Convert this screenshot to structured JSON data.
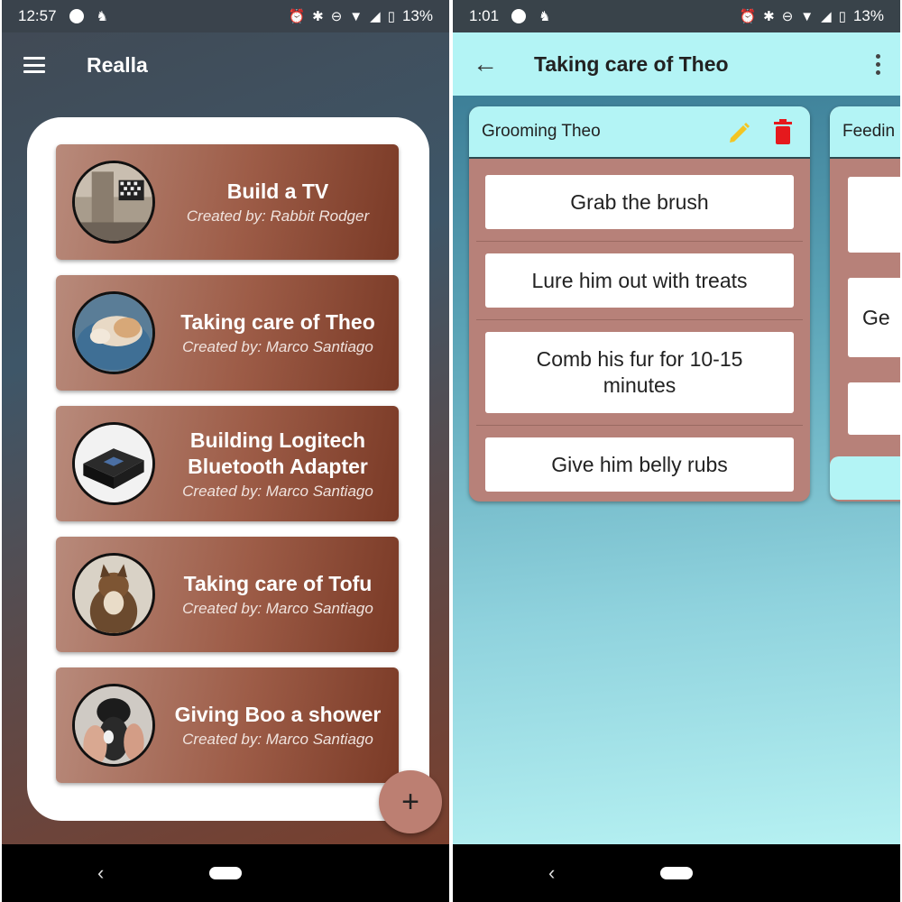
{
  "left_phone": {
    "status": {
      "time": "12:57",
      "battery": "13%"
    },
    "app_title": "Realla",
    "projects": [
      {
        "title": "Build a TV",
        "subtitle": "Created by: Rabbit Rodger",
        "image": "room-with-tv-photo"
      },
      {
        "title": "Taking care of Theo",
        "subtitle": "Created by: Marco Santiago",
        "image": "sleeping-cat-photo"
      },
      {
        "title": "Building Logitech Bluetooth Adapter",
        "subtitle": "Created by: Marco Santiago",
        "image": "bluetooth-adapter-photo"
      },
      {
        "title": "Taking care of Tofu",
        "subtitle": "Created by: Marco Santiago",
        "image": "fluffy-cat-photo"
      },
      {
        "title": "Giving Boo a shower",
        "subtitle": "Created by: Marco Santiago",
        "image": "cat-in-towel-photo"
      }
    ],
    "fab_label": "+",
    "nav": {
      "back": "‹"
    }
  },
  "right_phone": {
    "status": {
      "time": "1:01",
      "battery": "13%"
    },
    "title": "Taking care of Theo",
    "columns": [
      {
        "title": "Grooming Theo",
        "tasks": [
          "Grab the brush",
          "Lure him out with treats",
          "Comb his fur for 10-15 minutes",
          "Give him belly rubs"
        ]
      },
      {
        "title": "Feedin",
        "tasks": [
          "",
          "Ge",
          ""
        ]
      }
    ],
    "nav": {
      "back": "‹"
    }
  },
  "colors": {
    "card_brown": "#9d5c47",
    "header_cyan": "#b3f4f5",
    "column_brown": "#b78179",
    "pencil_yellow": "#f3c522",
    "trash_red": "#e5191d"
  }
}
